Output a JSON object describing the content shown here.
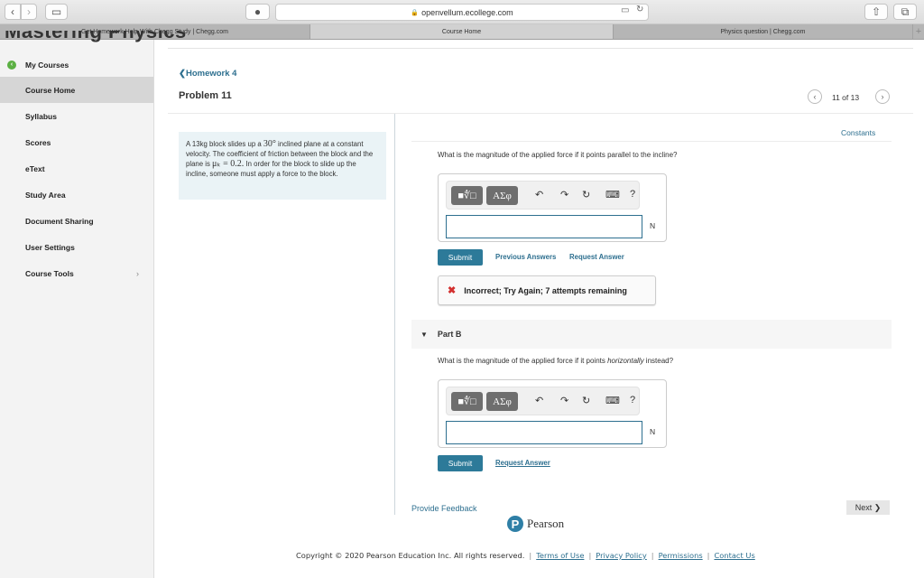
{
  "browser": {
    "url": "openvellum.ecollege.com",
    "tabs": [
      {
        "label": "Get Homework Help With Chegg Study | Chegg.com",
        "active": false
      },
      {
        "label": "Course Home",
        "active": true
      },
      {
        "label": "Physics question | Chegg.com",
        "active": false
      }
    ],
    "icons": {
      "back": "‹",
      "forward": "›",
      "sidebar": "▭",
      "extension": "●",
      "tabs_overview": "▭",
      "reload": "↻",
      "share": "⇧",
      "tabs": "⧉",
      "new_tab": "+",
      "lock": "🔒"
    }
  },
  "brand": "Mastering Physics",
  "sidebar": {
    "items": [
      {
        "label": "My Courses"
      },
      {
        "label": "Course Home",
        "active": true
      },
      {
        "label": "Syllabus"
      },
      {
        "label": "Scores"
      },
      {
        "label": "eText"
      },
      {
        "label": "Study Area"
      },
      {
        "label": "Document Sharing"
      },
      {
        "label": "User Settings"
      },
      {
        "label": "Course Tools"
      }
    ],
    "mycourses_icon": "‹",
    "tools_chevron": "›"
  },
  "header": {
    "back_link": "❮Homework 4",
    "title": "Problem 11",
    "counter": "11 of 13",
    "prev": "‹",
    "next": "›"
  },
  "problem": {
    "t1": "A 13kg block slides up a ",
    "angle": "30°",
    "t2": " inclined plane at a constant velocity.  The coefficient of friction between the block and the plane is ",
    "mu": "μₖ = 0.2.",
    "t3": "  In order for the block to slide up the incline, someone must apply a force to the block."
  },
  "constants_link": "Constants",
  "toolbar": {
    "template_label": "■∜□",
    "symbols_label": "ΑΣφ",
    "undo": "↶",
    "redo": "↷",
    "reset": "↻",
    "keyboard": "⌨",
    "help": "?"
  },
  "partA": {
    "question": "What is the magnitude of the applied force if it points parallel to the incline?",
    "answer_value": "",
    "unit": "N",
    "submit": "Submit",
    "previous_answers": "Previous Answers",
    "request_answer": "Request Answer",
    "feedback_icon": "✖",
    "feedback": "Incorrect; Try Again; 7 attempts remaining"
  },
  "partB": {
    "title": "Part B",
    "caret": "▼",
    "question_pre": "What is the magnitude of the applied force if it points ",
    "question_em": "horizontally",
    "question_post": " instead?",
    "answer_value": "",
    "unit": "N",
    "submit": "Submit",
    "request_answer": "Request Answer"
  },
  "footer": {
    "provide_feedback": "Provide Feedback",
    "next": "Next ❯",
    "pearson_logo": "P",
    "pearson_name": "Pearson",
    "copyright": "Copyright © 2020 Pearson Education Inc. All rights reserved.",
    "links": [
      "Terms of Use",
      "Privacy Policy",
      "Permissions",
      "Contact Us"
    ]
  },
  "colors": {
    "accent": "#2d6f8f",
    "submit": "#2d7a99",
    "error": "#d3302f",
    "mycourses": "#5bb043"
  }
}
